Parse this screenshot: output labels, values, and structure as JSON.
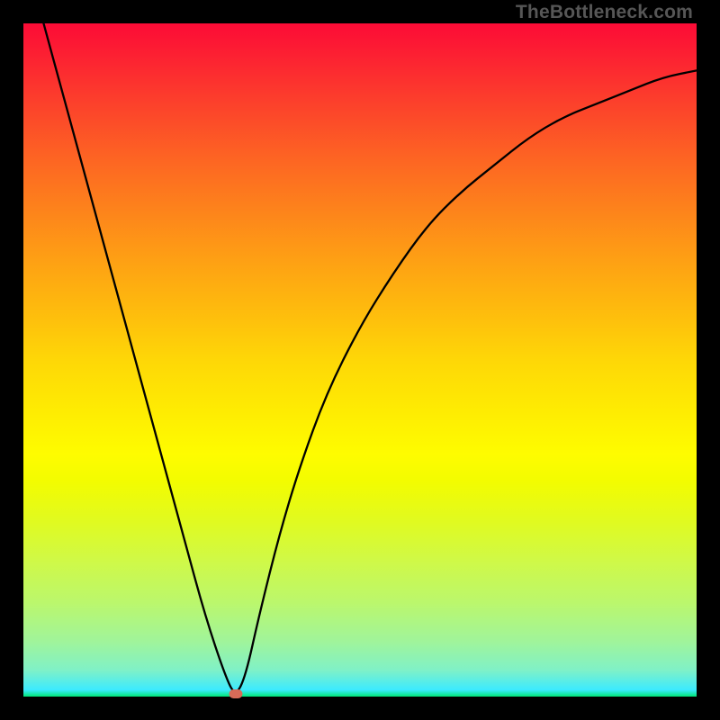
{
  "watermark": "TheBottleneck.com",
  "colors": {
    "frame": "#000000",
    "curve": "#000000",
    "marker": "#d86b58",
    "gradient_top": "#fc0b36",
    "gradient_bottom": "#00e676"
  },
  "chart_data": {
    "type": "line",
    "title": "",
    "xlabel": "",
    "ylabel": "",
    "xlim": [
      0,
      100
    ],
    "ylim": [
      0,
      100
    ],
    "x": [
      3,
      6,
      9,
      12,
      15,
      18,
      21,
      24,
      27,
      30,
      31.5,
      33,
      35,
      38,
      41,
      45,
      50,
      55,
      60,
      65,
      70,
      75,
      80,
      85,
      90,
      95,
      100
    ],
    "y": [
      100,
      89,
      78,
      67,
      56,
      45,
      34,
      23,
      12,
      3,
      0,
      3,
      12,
      24,
      34,
      45,
      55,
      63,
      70,
      75,
      79,
      83,
      86,
      88,
      90,
      92,
      93
    ],
    "marker": {
      "x": 31.5,
      "y": 0
    },
    "annotations": []
  }
}
